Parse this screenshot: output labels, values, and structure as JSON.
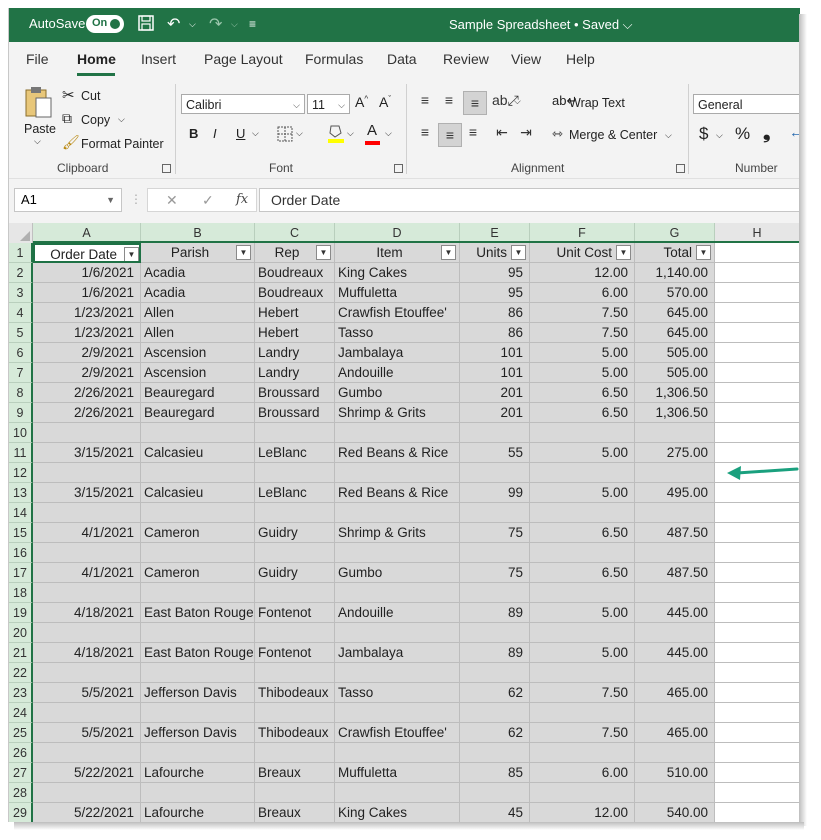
{
  "titlebar": {
    "autosave_label": "AutoSave",
    "toggle_state": "On",
    "title": "Sample Spreadsheet • Saved ⌵"
  },
  "tabs": [
    {
      "label": "File",
      "active": false
    },
    {
      "label": "Home",
      "active": true
    },
    {
      "label": "Insert",
      "active": false
    },
    {
      "label": "Page Layout",
      "active": false
    },
    {
      "label": "Formulas",
      "active": false
    },
    {
      "label": "Data",
      "active": false
    },
    {
      "label": "Review",
      "active": false
    },
    {
      "label": "View",
      "active": false
    },
    {
      "label": "Help",
      "active": false
    }
  ],
  "ribbon": {
    "clipboard": {
      "paste": "Paste",
      "cut": "Cut",
      "copy": "Copy",
      "format_painter": "Format Painter",
      "group": "Clipboard"
    },
    "font": {
      "font_name": "Calibri",
      "font_size": "11",
      "bold": "B",
      "italic": "I",
      "underline": "U",
      "group": "Font"
    },
    "alignment": {
      "wrap_text": "Wrap Text",
      "merge_center": "Merge & Center",
      "group": "Alignment"
    },
    "number": {
      "format": "General",
      "currency": "$",
      "percent": "%",
      "comma": "❟",
      "group": "Number"
    }
  },
  "formula_bar": {
    "name_box": "A1",
    "cancel": "✕",
    "enter": "✓",
    "fx": "fx",
    "formula": "Order Date"
  },
  "columns": [
    "A",
    "B",
    "C",
    "D",
    "E",
    "F",
    "G",
    "H"
  ],
  "header_row": [
    "Order Date",
    "Parish",
    "Rep",
    "Item",
    "Units",
    "Unit Cost",
    "Total"
  ],
  "rows": [
    {
      "num": "2",
      "cells": [
        "1/6/2021",
        "Acadia",
        "Boudreaux",
        "King Cakes",
        "95",
        "12.00",
        "1,140.00"
      ]
    },
    {
      "num": "3",
      "cells": [
        "1/6/2021",
        "Acadia",
        "Boudreaux",
        "Muffuletta",
        "95",
        "6.00",
        "570.00"
      ]
    },
    {
      "num": "4",
      "cells": [
        "1/23/2021",
        "Allen",
        "Hebert",
        "Crawfish Etouffee'",
        "86",
        "7.50",
        "645.00"
      ]
    },
    {
      "num": "5",
      "cells": [
        "1/23/2021",
        "Allen",
        "Hebert",
        "Tasso",
        "86",
        "7.50",
        "645.00"
      ]
    },
    {
      "num": "6",
      "cells": [
        "2/9/2021",
        "Ascension",
        "Landry",
        "Jambalaya",
        "101",
        "5.00",
        "505.00"
      ]
    },
    {
      "num": "7",
      "cells": [
        "2/9/2021",
        "Ascension",
        "Landry",
        "Andouille",
        "101",
        "5.00",
        "505.00"
      ]
    },
    {
      "num": "8",
      "cells": [
        "2/26/2021",
        "Beauregard",
        "Broussard",
        "Gumbo",
        "201",
        "6.50",
        "1,306.50"
      ]
    },
    {
      "num": "9",
      "cells": [
        "2/26/2021",
        "Beauregard",
        "Broussard",
        "Shrimp & Grits",
        "201",
        "6.50",
        "1,306.50"
      ]
    },
    {
      "num": "10",
      "cells": [
        "",
        "",
        "",
        "",
        "",
        "",
        ""
      ]
    },
    {
      "num": "11",
      "cells": [
        "3/15/2021",
        "Calcasieu",
        "LeBlanc",
        "Red Beans & Rice",
        "55",
        "5.00",
        "275.00"
      ]
    },
    {
      "num": "12",
      "cells": [
        "",
        "",
        "",
        "",
        "",
        "",
        ""
      ]
    },
    {
      "num": "13",
      "cells": [
        "3/15/2021",
        "Calcasieu",
        "LeBlanc",
        "Red Beans & Rice",
        "99",
        "5.00",
        "495.00"
      ]
    },
    {
      "num": "14",
      "cells": [
        "",
        "",
        "",
        "",
        "",
        "",
        ""
      ]
    },
    {
      "num": "15",
      "cells": [
        "4/1/2021",
        "Cameron",
        "Guidry",
        "Shrimp & Grits",
        "75",
        "6.50",
        "487.50"
      ]
    },
    {
      "num": "16",
      "cells": [
        "",
        "",
        "",
        "",
        "",
        "",
        ""
      ]
    },
    {
      "num": "17",
      "cells": [
        "4/1/2021",
        "Cameron",
        "Guidry",
        "Gumbo",
        "75",
        "6.50",
        "487.50"
      ]
    },
    {
      "num": "18",
      "cells": [
        "",
        "",
        "",
        "",
        "",
        "",
        ""
      ]
    },
    {
      "num": "19",
      "cells": [
        "4/18/2021",
        "East Baton Rouge",
        "Fontenot",
        "Andouille",
        "89",
        "5.00",
        "445.00"
      ]
    },
    {
      "num": "20",
      "cells": [
        "",
        "",
        "",
        "",
        "",
        "",
        ""
      ]
    },
    {
      "num": "21",
      "cells": [
        "4/18/2021",
        "East Baton Rouge",
        "Fontenot",
        "Jambalaya",
        "89",
        "5.00",
        "445.00"
      ]
    },
    {
      "num": "22",
      "cells": [
        "",
        "",
        "",
        "",
        "",
        "",
        ""
      ]
    },
    {
      "num": "23",
      "cells": [
        "5/5/2021",
        "Jefferson Davis",
        "Thibodeaux",
        "Tasso",
        "62",
        "7.50",
        "465.00"
      ]
    },
    {
      "num": "24",
      "cells": [
        "",
        "",
        "",
        "",
        "",
        "",
        ""
      ]
    },
    {
      "num": "25",
      "cells": [
        "5/5/2021",
        "Jefferson Davis",
        "Thibodeaux",
        "Crawfish Etouffee'",
        "62",
        "7.50",
        "465.00"
      ]
    },
    {
      "num": "26",
      "cells": [
        "",
        "",
        "",
        "",
        "",
        "",
        ""
      ]
    },
    {
      "num": "27",
      "cells": [
        "5/22/2021",
        "Lafourche",
        "Breaux",
        "Muffuletta",
        "85",
        "6.00",
        "510.00"
      ]
    },
    {
      "num": "28",
      "cells": [
        "",
        "",
        "",
        "",
        "",
        "",
        ""
      ]
    },
    {
      "num": "29",
      "cells": [
        "5/22/2021",
        "Lafourche",
        "Breaux",
        "King Cakes",
        "45",
        "12.00",
        "540.00"
      ]
    }
  ],
  "colors": {
    "excel_green": "#217346",
    "selection_fill": "#d9d9d9",
    "annotation_arrow": "#1aa07e"
  }
}
